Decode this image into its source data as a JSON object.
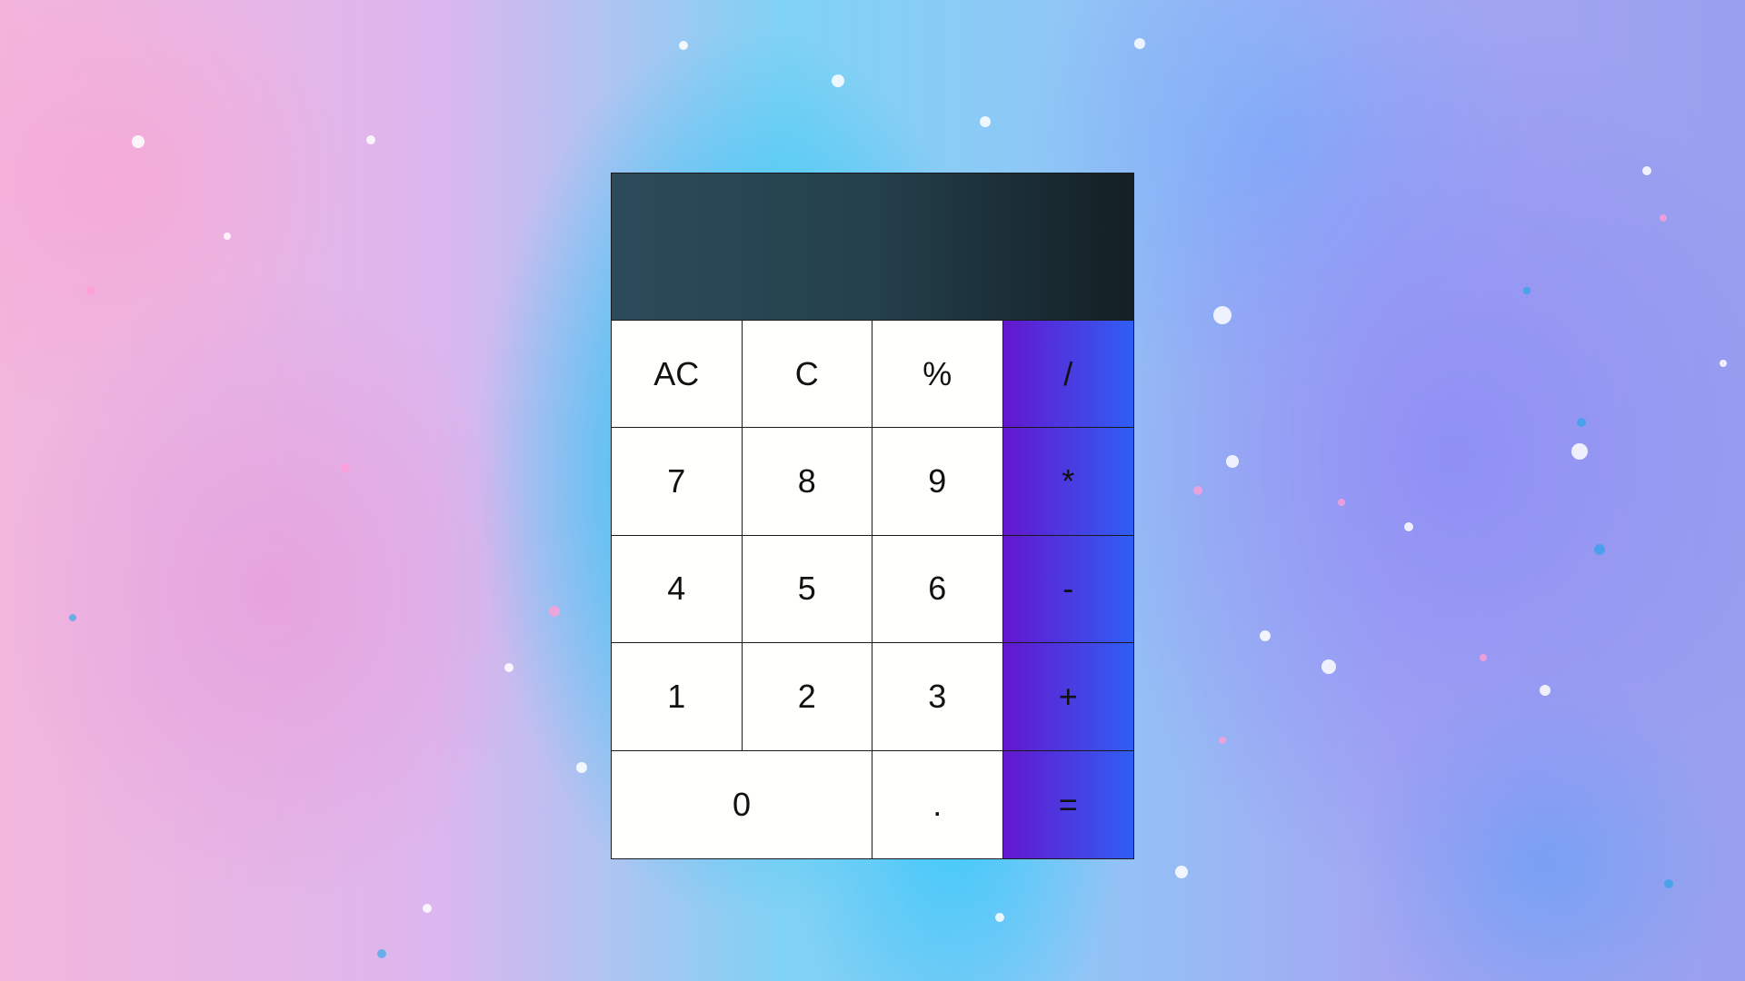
{
  "calculator": {
    "display_value": "",
    "keys": {
      "all_clear": "AC",
      "clear": "C",
      "percent": "%",
      "divide": "/",
      "seven": "7",
      "eight": "8",
      "nine": "9",
      "multiply": "*",
      "four": "4",
      "five": "5",
      "six": "6",
      "subtract": "-",
      "one": "1",
      "two": "2",
      "three": "3",
      "add": "+",
      "zero": "0",
      "decimal": ".",
      "equals": "="
    },
    "colors": {
      "display_start": "#2c4b5a",
      "display_end": "#131f24",
      "key_background": "#fffffb",
      "operator_start": "#6417cf",
      "operator_end": "#2f5ef4"
    }
  }
}
